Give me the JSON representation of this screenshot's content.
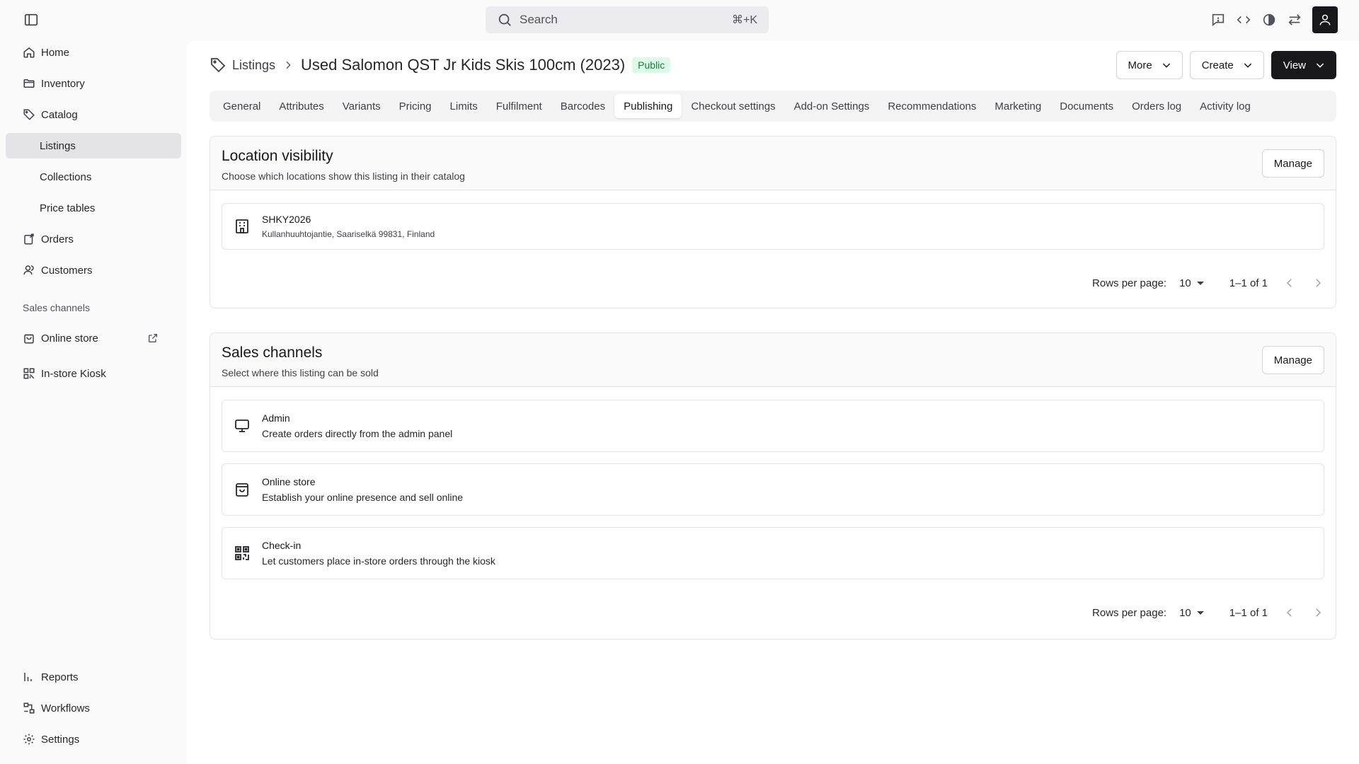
{
  "topbar": {
    "search_placeholder": "Search",
    "search_shortcut": "⌘+K",
    "icons": [
      "sidebar-toggle-icon",
      "feedback-icon",
      "code-icon",
      "theme-icon",
      "switch-icon",
      "user-icon"
    ]
  },
  "sidebar": {
    "items": [
      {
        "label": "Home",
        "icon": "home-icon"
      },
      {
        "label": "Inventory",
        "icon": "folder-icon"
      },
      {
        "label": "Catalog",
        "icon": "tag-icon"
      },
      {
        "label": "Listings"
      },
      {
        "label": "Collections"
      },
      {
        "label": "Price tables"
      },
      {
        "label": "Orders",
        "icon": "orders-icon"
      },
      {
        "label": "Customers",
        "icon": "users-icon"
      }
    ],
    "section_label": "Sales channels",
    "channels": [
      {
        "label": "Online store",
        "icon": "store-icon"
      },
      {
        "label": "In-store Kiosk",
        "icon": "kiosk-icon"
      }
    ],
    "bottom": [
      {
        "label": "Reports",
        "icon": "reports-icon"
      },
      {
        "label": "Workflows",
        "icon": "workflows-icon"
      },
      {
        "label": "Settings",
        "icon": "gear-icon"
      }
    ]
  },
  "header": {
    "breadcrumb": "Listings",
    "title": "Used Salomon QST Jr Kids Skis 100cm (2023)",
    "badge": "Public",
    "buttons": {
      "more": "More",
      "create": "Create",
      "view": "View"
    }
  },
  "tabs": [
    "General",
    "Attributes",
    "Variants",
    "Pricing",
    "Limits",
    "Fulfilment",
    "Barcodes",
    "Publishing",
    "Checkout settings",
    "Add-on Settings",
    "Recommendations",
    "Marketing",
    "Documents",
    "Orders log",
    "Activity log"
  ],
  "active_tab": "Publishing",
  "location_visibility": {
    "title": "Location visibility",
    "description": "Choose which locations show this listing in their catalog",
    "manage": "Manage",
    "rows": [
      {
        "name": "SHKY2026",
        "address": "Kullanhuuhtojantie, Saariselkä 99831, Finland"
      }
    ],
    "pager": {
      "rows_per_page_label": "Rows per page:",
      "rows_per_page": "10",
      "range": "1–1 of 1"
    }
  },
  "sales_channels": {
    "title": "Sales channels",
    "description": "Select where this listing can be sold",
    "manage": "Manage",
    "rows": [
      {
        "name": "Admin",
        "description": "Create orders directly from the admin panel",
        "icon": "monitor-icon"
      },
      {
        "name": "Online store",
        "description": "Establish your online presence and sell online",
        "icon": "shopping-bag-icon"
      },
      {
        "name": "Check-in",
        "description": "Let customers place in-store orders through the kiosk",
        "icon": "qr-code-icon"
      }
    ],
    "pager": {
      "rows_per_page_label": "Rows per page:",
      "rows_per_page": "10",
      "range": "1–1 of 1"
    }
  },
  "colors": {
    "accent": "#18181b",
    "badge_text": "#15803d",
    "badge_bg": "#dcfce7",
    "active_nav": "#e4e4e7"
  }
}
